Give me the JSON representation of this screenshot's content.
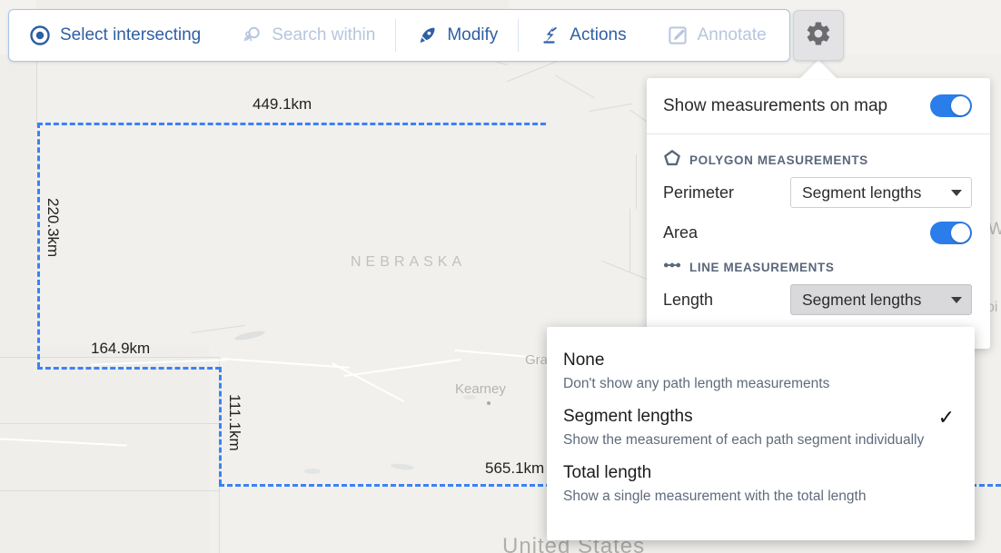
{
  "toolbar": {
    "items": [
      {
        "label": "Select intersecting",
        "icon": "target-icon",
        "state": "enabled"
      },
      {
        "label": "Search within",
        "icon": "search-person-icon",
        "state": "disabled"
      },
      {
        "label": "Modify",
        "icon": "pen-nib-icon",
        "state": "enabled"
      },
      {
        "label": "Actions",
        "icon": "lightning-actions-icon",
        "state": "enabled"
      },
      {
        "label": "Annotate",
        "icon": "annotate-pencil-icon",
        "state": "disabled"
      }
    ],
    "settings_button_icon": "gear-icon",
    "accent_color": "#2e5fa3",
    "disabled_color": "#b6c6de",
    "border_color": "#a7c4ea"
  },
  "settings_panel": {
    "show_measurements_label": "Show measurements on map",
    "show_measurements_on": true,
    "toggle_on_color": "#2b7de9",
    "sections": [
      {
        "icon": "polygon-icon",
        "title": "POLYGON MEASUREMENTS",
        "rows": [
          {
            "type": "select",
            "label": "Perimeter",
            "value": "Segment lengths",
            "active": false
          },
          {
            "type": "toggle",
            "label": "Area",
            "on": true
          }
        ]
      },
      {
        "icon": "line-measure-icon",
        "title": "LINE MEASUREMENTS",
        "rows": [
          {
            "type": "select",
            "label": "Length",
            "value": "Segment lengths",
            "active": true
          }
        ]
      }
    ]
  },
  "dropdown_menu": {
    "options": [
      {
        "title": "None",
        "description": "Don't show any path length measurements",
        "selected": false
      },
      {
        "title": "Segment lengths",
        "description": "Show the measurement of each path segment individually",
        "selected": true
      },
      {
        "title": "Total length",
        "description": "Show a single measurement with the total length",
        "selected": false
      }
    ],
    "check_glyph": "✓"
  },
  "map": {
    "labels": [
      {
        "name": "state-label",
        "text": "NEBRASKA",
        "kind": "state"
      },
      {
        "name": "city-label-grand-island",
        "text": "Grand",
        "kind": "city"
      },
      {
        "name": "city-label-kearney",
        "text": "Kearney",
        "kind": "city"
      },
      {
        "name": "country-label",
        "text": "United States",
        "kind": "country"
      },
      {
        "name": "edge-label-w",
        "text": "W",
        "kind": "edge"
      },
      {
        "name": "edge-label-oi",
        "text": "oi",
        "kind": "edge"
      }
    ],
    "selection_color": "#3b82f6",
    "measurements": [
      {
        "name": "measurement-top",
        "value": "449.1km",
        "orientation": "horizontal"
      },
      {
        "name": "measurement-left",
        "value": "220.3km",
        "orientation": "vertical"
      },
      {
        "name": "measurement-lower-left",
        "value": "164.9km",
        "orientation": "horizontal"
      },
      {
        "name": "measurement-inner-vertical",
        "value": "111.1km",
        "orientation": "vertical"
      },
      {
        "name": "measurement-bottom",
        "value": "565.1km",
        "orientation": "horizontal"
      }
    ]
  }
}
